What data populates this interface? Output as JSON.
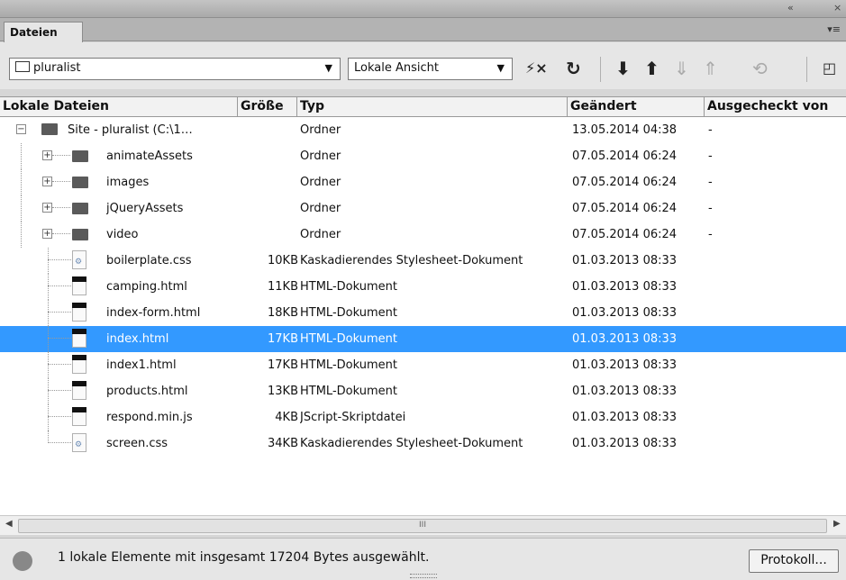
{
  "panel": {
    "tab_label": "Dateien",
    "collapse_glyph": "«",
    "close_glyph": "×",
    "menu_glyph": "▾≡"
  },
  "toolbar": {
    "site": "pluralist",
    "view": "Lokale Ansicht",
    "icons": [
      "connect-icon",
      "refresh-icon",
      "get-icon",
      "put-icon",
      "checkout-icon",
      "checkin-icon",
      "sync-icon",
      "expand-icon"
    ]
  },
  "columns": {
    "name": "Lokale Dateien",
    "size": "Größe",
    "type": "Typ",
    "date": "Geändert",
    "checked": "Ausgecheckt von"
  },
  "rows": [
    {
      "name": "Site - pluralist (C:\\1…",
      "size": "",
      "type": "Ordner",
      "date": "13.05.2014 04:38",
      "checked": "-",
      "kind": "root",
      "tree": "−"
    },
    {
      "name": "animateAssets",
      "size": "",
      "type": "Ordner",
      "date": "07.05.2014 06:24",
      "checked": "-",
      "kind": "folder",
      "tree": "+"
    },
    {
      "name": "images",
      "size": "",
      "type": "Ordner",
      "date": "07.05.2014 06:24",
      "checked": "-",
      "kind": "folder",
      "tree": "+"
    },
    {
      "name": "jQueryAssets",
      "size": "",
      "type": "Ordner",
      "date": "07.05.2014 06:24",
      "checked": "-",
      "kind": "folder",
      "tree": "+"
    },
    {
      "name": "video",
      "size": "",
      "type": "Ordner",
      "date": "07.05.2014 06:24",
      "checked": "-",
      "kind": "folder",
      "tree": "+"
    },
    {
      "name": "boilerplate.css",
      "size": "10KB",
      "type": "Kaskadierendes Stylesheet-Dokument",
      "date": "01.03.2013 08:33",
      "checked": "",
      "kind": "css"
    },
    {
      "name": "camping.html",
      "size": "11KB",
      "type": "HTML-Dokument",
      "date": "01.03.2013 08:33",
      "checked": "",
      "kind": "html"
    },
    {
      "name": "index-form.html",
      "size": "18KB",
      "type": "HTML-Dokument",
      "date": "01.03.2013 08:33",
      "checked": "",
      "kind": "html"
    },
    {
      "name": "index.html",
      "size": "17KB",
      "type": "HTML-Dokument",
      "date": "01.03.2013 08:33",
      "checked": "",
      "kind": "html",
      "selected": true
    },
    {
      "name": "index1.html",
      "size": "17KB",
      "type": "HTML-Dokument",
      "date": "01.03.2013 08:33",
      "checked": "",
      "kind": "html"
    },
    {
      "name": "products.html",
      "size": "13KB",
      "type": "HTML-Dokument",
      "date": "01.03.2013 08:33",
      "checked": "",
      "kind": "html"
    },
    {
      "name": "respond.min.js",
      "size": "4KB",
      "type": "JScript-Skriptdatei",
      "date": "01.03.2013 08:33",
      "checked": "",
      "kind": "js"
    },
    {
      "name": "screen.css",
      "size": "34KB",
      "type": "Kaskadierendes Stylesheet-Dokument",
      "date": "01.03.2013 08:33",
      "checked": "",
      "kind": "css"
    }
  ],
  "scrollbar": {
    "thumb_glyph": "III"
  },
  "status": {
    "text": "1 lokale Elemente mit insgesamt 17204 Bytes ausgewählt.",
    "log_button": "Protokoll..."
  },
  "colors": {
    "selection": "#3399ff"
  }
}
